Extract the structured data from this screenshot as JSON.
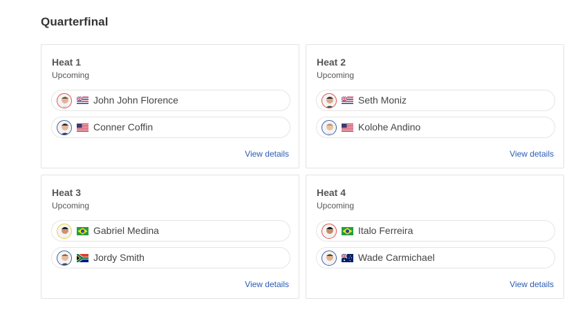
{
  "round": {
    "title": "Quarterfinal"
  },
  "colors": {
    "link": "#2a5bb3",
    "hawaii_avatar_ring": "#d9534f",
    "usa_avatar_ring": "#3b5fa8",
    "brazil_yellow_ring": "#e8d23a",
    "brazil_red_ring": "#d9534f"
  },
  "heats": [
    {
      "title": "Heat 1",
      "status": "Upcoming",
      "link": "View details",
      "athletes": [
        {
          "name": "John John Florence",
          "flag": "hawaii-flag",
          "ring": "#d9534f"
        },
        {
          "name": "Conner Coffin",
          "flag": "usa-flag",
          "ring": "#3b5fa8"
        }
      ]
    },
    {
      "title": "Heat 2",
      "status": "Upcoming",
      "link": "View details",
      "athletes": [
        {
          "name": "Seth Moniz",
          "flag": "hawaii-flag",
          "ring": "#d9534f"
        },
        {
          "name": "Kolohe Andino",
          "flag": "usa-flag",
          "ring": "#3b5fa8"
        }
      ]
    },
    {
      "title": "Heat 3",
      "status": "Upcoming",
      "link": "View details",
      "athletes": [
        {
          "name": "Gabriel Medina",
          "flag": "brazil-flag",
          "ring": "#e8d23a"
        },
        {
          "name": "Jordy Smith",
          "flag": "south-africa-flag",
          "ring": "#3b5fa8"
        }
      ]
    },
    {
      "title": "Heat 4",
      "status": "Upcoming",
      "link": "View details",
      "athletes": [
        {
          "name": "Italo Ferreira",
          "flag": "brazil-flag",
          "ring": "#d9534f"
        },
        {
          "name": "Wade Carmichael",
          "flag": "australia-flag",
          "ring": "#3b5fa8"
        }
      ]
    }
  ]
}
